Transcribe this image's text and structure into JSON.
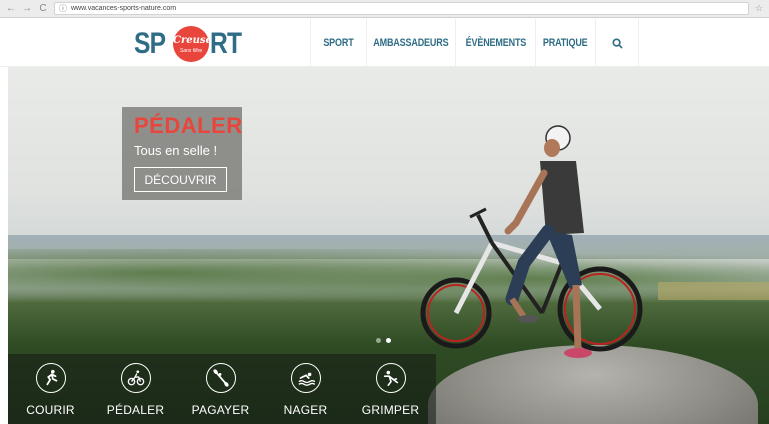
{
  "browser": {
    "back_glyph": "←",
    "forward_glyph": "→",
    "reload_glyph": "C",
    "info_glyph": "ⓘ",
    "url": "www.vacances-sports-nature.com",
    "bookmark_glyph": "☆"
  },
  "logo": {
    "left": "SP",
    "circle_top": "Creuse",
    "circle_bottom": "Sans filtre",
    "right": "RT",
    "colors": {
      "blue": "#2f6d86",
      "red": "#e8463c"
    }
  },
  "nav": {
    "items": [
      "SPORT",
      "AMBASSADEURS",
      "ÉVÈNEMENTS",
      "PRATIQUE"
    ],
    "search_glyph": "🔍︎"
  },
  "slide": {
    "title": "PÉDALER",
    "subtitle": "Tous en selle !",
    "button": "DÉCOUVRIR",
    "dots_count": 2,
    "active_dot": 1
  },
  "sports": [
    {
      "label": "COURIR",
      "icon": "running-icon"
    },
    {
      "label": "PÉDALER",
      "icon": "bike-icon"
    },
    {
      "label": "PAGAYER",
      "icon": "paddle-icon"
    },
    {
      "label": "NAGER",
      "icon": "swimming-icon"
    },
    {
      "label": "GRIMPER",
      "icon": "climbing-icon"
    }
  ]
}
